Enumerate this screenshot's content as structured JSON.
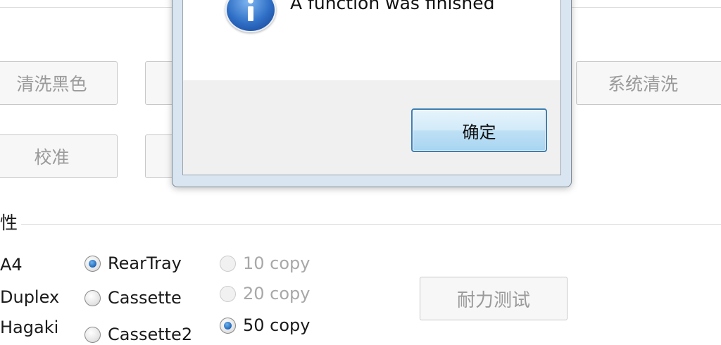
{
  "buttons": {
    "clean_black": "清洗黑色",
    "system_clean": "系统清洗",
    "calibrate": "校准",
    "endurance_test": "耐力测试"
  },
  "group": {
    "label": "性"
  },
  "paper_options": [
    "A4",
    "Duplex",
    "Hagaki"
  ],
  "source_options": [
    {
      "label": "RearTray",
      "checked": true
    },
    {
      "label": "Cassette",
      "checked": false
    },
    {
      "label": "Cassette2",
      "checked": false
    }
  ],
  "copy_options": [
    {
      "label": "10 copy",
      "checked": false,
      "disabled": true
    },
    {
      "label": "20 copy",
      "checked": false,
      "disabled": true
    },
    {
      "label": "50 copy",
      "checked": true,
      "disabled": false
    }
  ],
  "dialog": {
    "message": "A function was finished",
    "ok_label": "确定",
    "icon": "info-icon"
  }
}
